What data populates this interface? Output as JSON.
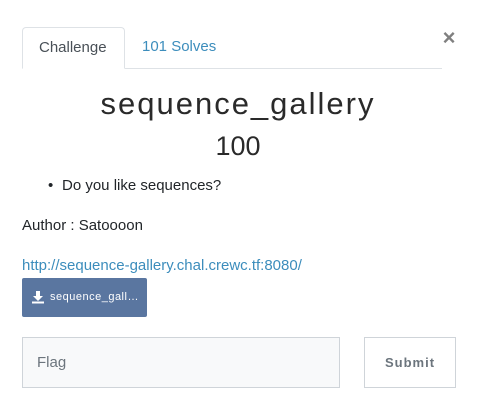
{
  "modal": {
    "close_glyph": "×"
  },
  "tabs": [
    {
      "label": "Challenge",
      "active": true
    },
    {
      "label": "101 Solves",
      "active": false
    }
  ],
  "challenge": {
    "name": "sequence_gallery",
    "points": "100",
    "description_items": [
      "Do you like sequences?"
    ],
    "author": "Author : Satoooon",
    "link": "http://sequence-gallery.chal.crewc.tf:8080/",
    "file_label": "sequence_gallery.tar.gz",
    "file_icon": "download-icon"
  },
  "submit_form": {
    "flag_placeholder": "Flag",
    "flag_value": "",
    "submit_label": "Submit"
  },
  "colors": {
    "link": "#3c8dbc",
    "file_button": "#5a76a0",
    "input_bg": "#f8f9fa"
  }
}
